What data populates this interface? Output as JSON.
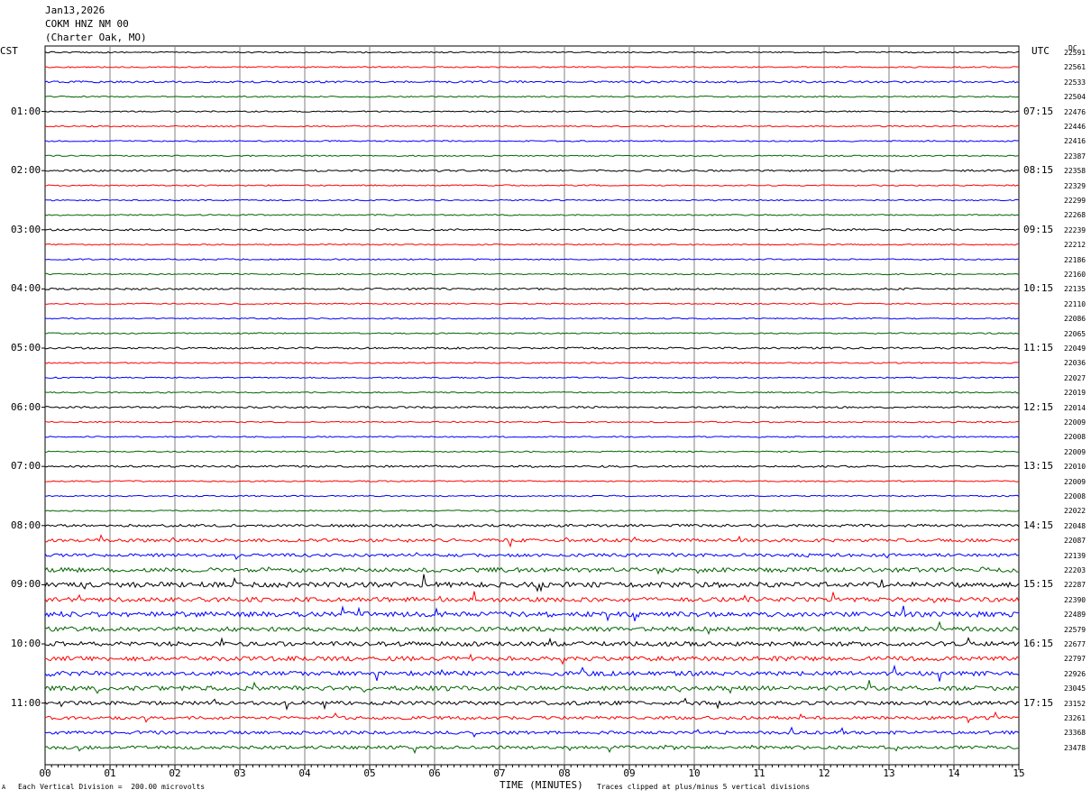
{
  "header": {
    "date": "Jan13,2026",
    "station": "COKM HNZ NM 00",
    "location": "(Charter Oak, MO)"
  },
  "left_tz": "CST",
  "right_tz": "UTC",
  "dc_label": "DC",
  "footer": {
    "scale": "Each Vertical Division =  200.00 microvolts",
    "xlabel": "TIME (MINUTES)",
    "clip": "Traces clipped at plus/minus 5 vertical divisions",
    "corner_mark": "A"
  },
  "chart_data": {
    "type": "line",
    "title": "COKM HNZ NM 00",
    "xlabel": "TIME (MINUTES)",
    "ylabel": "",
    "xlim": [
      0,
      15
    ],
    "x_ticks": [
      "00",
      "01",
      "02",
      "03",
      "04",
      "05",
      "06",
      "07",
      "08",
      "09",
      "10",
      "11",
      "12",
      "13",
      "14",
      "15"
    ],
    "trace_colors": [
      "#000000",
      "#ff0000",
      "#0000ff",
      "#006400"
    ],
    "left_hour_labels": [
      "01:00",
      "02:00",
      "03:00",
      "04:00",
      "05:00",
      "06:00",
      "07:00",
      "08:00",
      "09:00",
      "10:00",
      "11:00"
    ],
    "right_hour_labels": [
      "07:15",
      "08:15",
      "09:15",
      "10:15",
      "11:15",
      "12:15",
      "13:15",
      "14:15",
      "15:15",
      "16:15",
      "17:15"
    ],
    "dc_offsets": [
      "22591",
      "22561",
      "22533",
      "22504",
      "22476",
      "22446",
      "22416",
      "22387",
      "22358",
      "22329",
      "22299",
      "22268",
      "22239",
      "22212",
      "22186",
      "22160",
      "22135",
      "22110",
      "22086",
      "22065",
      "22049",
      "22036",
      "22027",
      "22019",
      "22014",
      "22009",
      "22008",
      "22009",
      "22010",
      "22009",
      "22008",
      "22022",
      "22048",
      "22087",
      "22139",
      "22203",
      "22287",
      "22390",
      "22489",
      "22579",
      "22677",
      "22797",
      "22926",
      "23045",
      "23152",
      "23261",
      "23368",
      "23478"
    ],
    "trace_noise_level": [
      1,
      1,
      1.5,
      1,
      1,
      1,
      1,
      1,
      1.5,
      1,
      1,
      1,
      1.5,
      1,
      1,
      1,
      1.5,
      1,
      1,
      1,
      1.5,
      1,
      1,
      1,
      1.5,
      1,
      1,
      1,
      1.5,
      1,
      1,
      1,
      2,
      2.5,
      2.5,
      3.5,
      4,
      3.5,
      4,
      3.5,
      3.5,
      3.5,
      3.5,
      3.5,
      3,
      2.5,
      2.5,
      2.5
    ],
    "grid": true,
    "legend": "none"
  }
}
